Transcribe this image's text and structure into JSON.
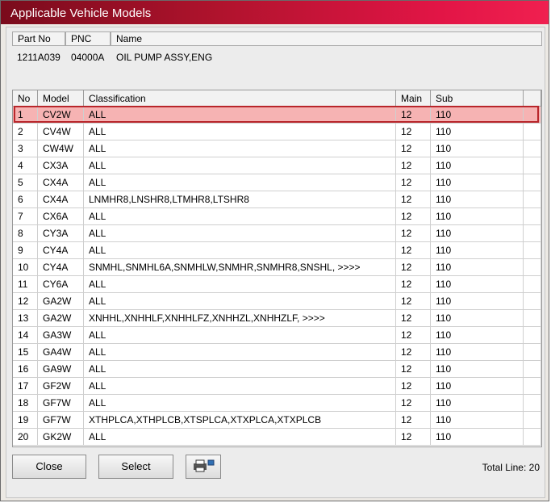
{
  "window": {
    "title": "Applicable Vehicle Models"
  },
  "part": {
    "headers": [
      "Part No",
      "PNC",
      "Name"
    ],
    "part_no": "1211A039",
    "pnc": "04000A",
    "name": "OIL PUMP ASSY,ENG"
  },
  "grid": {
    "columns": [
      "No",
      "Model",
      "Classification",
      "Main",
      "Sub"
    ],
    "selected_row": 0,
    "rows": [
      {
        "no": "1",
        "model": "CV2W",
        "classification": "ALL",
        "main": "12",
        "sub": "110"
      },
      {
        "no": "2",
        "model": "CV4W",
        "classification": "ALL",
        "main": "12",
        "sub": "110"
      },
      {
        "no": "3",
        "model": "CW4W",
        "classification": "ALL",
        "main": "12",
        "sub": "110"
      },
      {
        "no": "4",
        "model": "CX3A",
        "classification": "ALL",
        "main": "12",
        "sub": "110"
      },
      {
        "no": "5",
        "model": "CX4A",
        "classification": "ALL",
        "main": "12",
        "sub": "110"
      },
      {
        "no": "6",
        "model": "CX4A",
        "classification": "LNMHR8,LNSHR8,LTMHR8,LTSHR8",
        "main": "12",
        "sub": "110"
      },
      {
        "no": "7",
        "model": "CX6A",
        "classification": "ALL",
        "main": "12",
        "sub": "110"
      },
      {
        "no": "8",
        "model": "CY3A",
        "classification": "ALL",
        "main": "12",
        "sub": "110"
      },
      {
        "no": "9",
        "model": "CY4A",
        "classification": "ALL",
        "main": "12",
        "sub": "110"
      },
      {
        "no": "10",
        "model": "CY4A",
        "classification": "SNMHL,SNMHL6A,SNMHLW,SNMHR,SNMHR8,SNSHL, >>>>",
        "main": "12",
        "sub": "110"
      },
      {
        "no": "11",
        "model": "CY6A",
        "classification": "ALL",
        "main": "12",
        "sub": "110"
      },
      {
        "no": "12",
        "model": "GA2W",
        "classification": "ALL",
        "main": "12",
        "sub": "110"
      },
      {
        "no": "13",
        "model": "GA2W",
        "classification": "XNHHL,XNHHLF,XNHHLFZ,XNHHZL,XNHHZLF, >>>>",
        "main": "12",
        "sub": "110"
      },
      {
        "no": "14",
        "model": "GA3W",
        "classification": "ALL",
        "main": "12",
        "sub": "110"
      },
      {
        "no": "15",
        "model": "GA4W",
        "classification": "ALL",
        "main": "12",
        "sub": "110"
      },
      {
        "no": "16",
        "model": "GA9W",
        "classification": "ALL",
        "main": "12",
        "sub": "110"
      },
      {
        "no": "17",
        "model": "GF2W",
        "classification": "ALL",
        "main": "12",
        "sub": "110"
      },
      {
        "no": "18",
        "model": "GF7W",
        "classification": "ALL",
        "main": "12",
        "sub": "110"
      },
      {
        "no": "19",
        "model": "GF7W",
        "classification": "XTHPLCA,XTHPLCB,XTSPLCA,XTXPLCA,XTXPLCB",
        "main": "12",
        "sub": "110"
      },
      {
        "no": "20",
        "model": "GK2W",
        "classification": "ALL",
        "main": "12",
        "sub": "110"
      }
    ]
  },
  "buttons": {
    "close": "Close",
    "select": "Select",
    "print_icon": "printer-icon"
  },
  "footer": {
    "total": "Total Line: 20"
  }
}
